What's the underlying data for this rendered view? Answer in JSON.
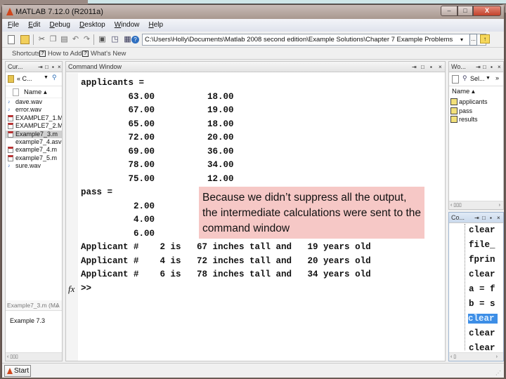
{
  "window": {
    "title": "MATLAB  7.12.0 (R2011a)",
    "controls": {
      "minimize": "–",
      "maximize": "□",
      "close": "X"
    }
  },
  "menu": [
    "File",
    "Edit",
    "Debug",
    "Desktop",
    "Window",
    "Help"
  ],
  "toolbar": {
    "icons": [
      "new-file-icon",
      "open-folder-icon",
      "cut-icon",
      "copy-icon",
      "paste-icon",
      "undo-icon",
      "redo-icon",
      "simulink-icon",
      "guide-icon",
      "profiler-icon",
      "help-icon"
    ],
    "current_folder": "C:\\Users\\Holly\\Documents\\Matlab 2008   second edition\\Example Solutions\\Chapter 7 Example Problems",
    "browse_label": "...",
    "dropdown_glyph": "▾"
  },
  "shortcuts": {
    "label": "Shortcuts",
    "items": [
      "How to Add",
      "What's New"
    ]
  },
  "current_folder_panel": {
    "title": "Cur...",
    "nav_label": "« C...",
    "name_header": "Name ▴",
    "files": [
      {
        "name": "dave.wav",
        "type": "wav",
        "selected": false
      },
      {
        "name": "error.wav",
        "type": "wav",
        "selected": false
      },
      {
        "name": "EXAMPLE7_1.M",
        "type": "m",
        "selected": false
      },
      {
        "name": "EXAMPLE7_2.M",
        "type": "m",
        "selected": false
      },
      {
        "name": "Example7_3.m",
        "type": "m",
        "selected": true
      },
      {
        "name": "example7_4.asv",
        "type": "asv",
        "selected": false
      },
      {
        "name": "example7_4.m",
        "type": "m",
        "selected": false
      },
      {
        "name": "example7_5.m",
        "type": "m",
        "selected": false
      },
      {
        "name": "sure.wav",
        "type": "wav",
        "selected": false
      }
    ],
    "details_header": "Example7_3.m (MA",
    "details_text": "Example 7.3",
    "scroll_glyph": "‹  ▯▯▯"
  },
  "command_window": {
    "title": "Command Window",
    "lines": [
      {
        "text": "applicants =",
        "row": 0
      },
      {
        "text": "         63.00          18.00",
        "row": 1
      },
      {
        "text": "         67.00          19.00",
        "row": 2
      },
      {
        "text": "         65.00          18.00",
        "row": 3
      },
      {
        "text": "         72.00          20.00",
        "row": 4
      },
      {
        "text": "         69.00          36.00",
        "row": 5
      },
      {
        "text": "         78.00          34.00",
        "row": 6
      },
      {
        "text": "         75.00          12.00",
        "row": 7
      },
      {
        "text": "pass =",
        "row": 8
      },
      {
        "text": "          2.00",
        "row": 9
      },
      {
        "text": "          4.00",
        "row": 10
      },
      {
        "text": "          6.00",
        "row": 11
      },
      {
        "text": "Applicant #    2 is   67 inches tall and   19 years old",
        "row": 12
      },
      {
        "text": "Applicant #    4 is   72 inches tall and   20 years old",
        "row": 13
      },
      {
        "text": "Applicant #    6 is   78 inches tall and   34 years old",
        "row": 14
      },
      {
        "text": ">>",
        "row": 15
      }
    ],
    "fx_label": "fx",
    "callout": "Because we didn’t suppress all the output, the intermediate calculations were sent to the command window"
  },
  "workspace_panel": {
    "title": "Wo...",
    "select_label": "Sel...",
    "name_header": "Name ▴",
    "variables": [
      "applicants",
      "pass",
      "results"
    ]
  },
  "history_panel": {
    "title": "Co...",
    "entries": [
      {
        "text": "clear",
        "selected": false
      },
      {
        "text": "file_",
        "selected": false
      },
      {
        "text": "fprin",
        "selected": false
      },
      {
        "text": "clear",
        "selected": false
      },
      {
        "text": "a = f",
        "selected": false
      },
      {
        "text": "b = s",
        "selected": false
      },
      {
        "text": "clear",
        "selected": true
      },
      {
        "text": "clear",
        "selected": false
      },
      {
        "text": "clear",
        "selected": false
      }
    ]
  },
  "statusbar": {
    "start_label": "Start"
  },
  "colors": {
    "callout_bg": "#f6c8c6",
    "history_selection": "#3d8ee6",
    "matlab_logo": "#d0461b"
  }
}
